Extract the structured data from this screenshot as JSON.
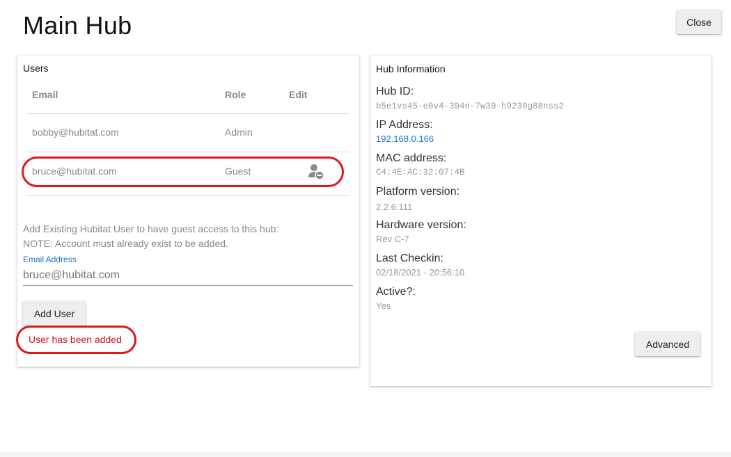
{
  "page": {
    "title": "Main Hub",
    "close_label": "Close"
  },
  "users": {
    "title": "Users",
    "columns": {
      "email": "Email",
      "role": "Role",
      "edit": "Edit"
    },
    "rows": [
      {
        "email": "bobby@hubitat.com",
        "role": "Admin",
        "editable": false
      },
      {
        "email": "bruce@hubitat.com",
        "role": "Guest",
        "editable": true,
        "edit_icon": "remove-user-icon"
      }
    ],
    "instructions": "Add Existing Hubitat User to have guest access to this hub:",
    "note": "NOTE: Account must already exist to be added.",
    "email_field": {
      "label": "Email Address",
      "value": "bruce@hubitat.com"
    },
    "add_button_label": "Add User",
    "status_message": "User has been added"
  },
  "hub_info": {
    "title": "Hub Information",
    "hub_id": {
      "label": "Hub ID:",
      "value": "b5e1vs45-e0v4-394n-7w39-h9230g88nss2"
    },
    "ip_address": {
      "label": "IP Address:",
      "value": "192.168.0.166"
    },
    "mac_address": {
      "label": "MAC address:",
      "value": "C4:4E:AC:32:07:4B"
    },
    "platform_version": {
      "label": "Platform version:",
      "value": "2.2.6.111"
    },
    "hardware_version": {
      "label": "Hardware version:",
      "value": "Rev C-7"
    },
    "last_checkin": {
      "label": "Last Checkin:",
      "value": "02/18/2021 - 20:56:10"
    },
    "active": {
      "label": "Active?:",
      "value": "Yes"
    },
    "advanced_label": "Advanced"
  },
  "colors": {
    "highlight": "#e0161b",
    "link": "#1a73c4",
    "status_error_red": "#d0141a",
    "button_bg": "#eeeeee"
  }
}
